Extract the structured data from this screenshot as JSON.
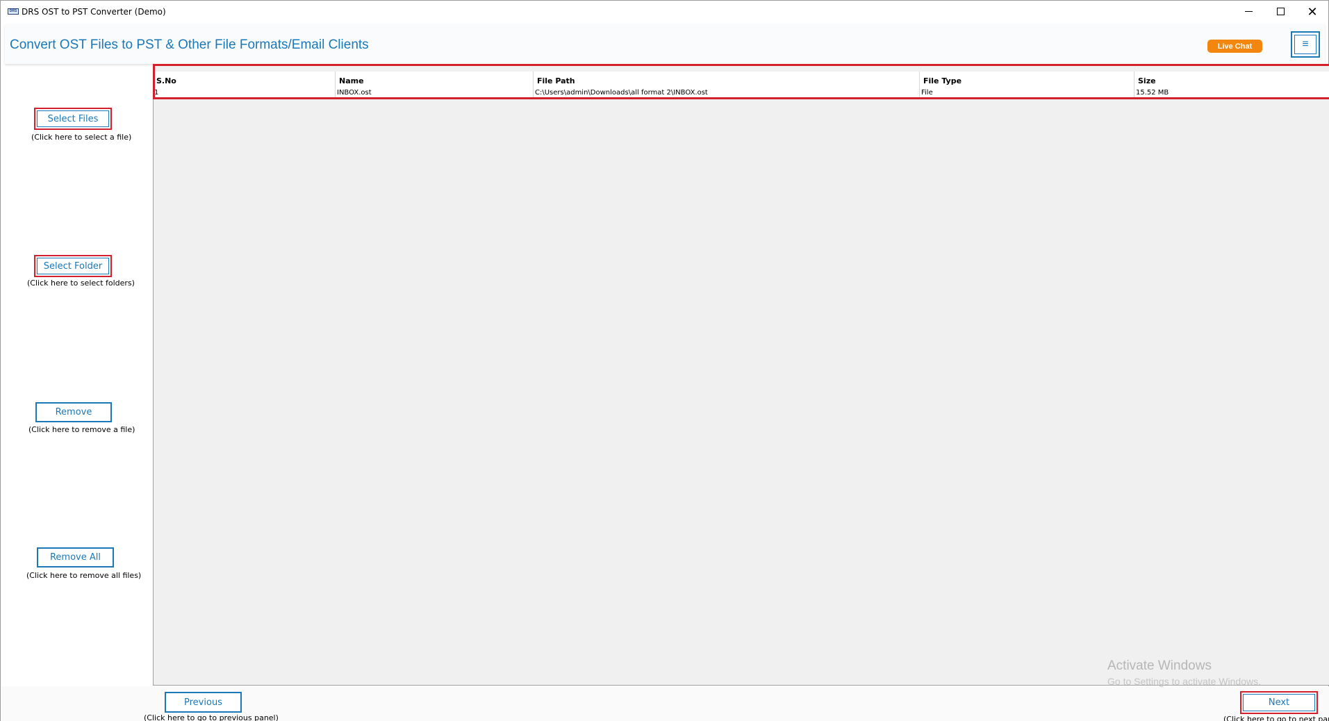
{
  "window": {
    "title": "DRS OST to PST Converter (Demo)",
    "icon": "drs-app-icon",
    "icon_text": "DRS",
    "minimize_icon": "minimize-icon",
    "maximize_icon": "maximize-icon",
    "close_glyph": "✕"
  },
  "header": {
    "title": "Convert OST Files to PST & Other File Formats/Email Clients",
    "live_chat": "Live Chat",
    "menu_glyph": "≡",
    "accent_color": "#1a78b8",
    "live_chat_color": "#f2860f"
  },
  "sidebar": {
    "select_files": {
      "label": "Select Files",
      "hint": "(Click here to select a file)"
    },
    "select_folder": {
      "label": "Select Folder",
      "hint": "(Click here to select folders)"
    },
    "remove": {
      "label": "Remove",
      "hint": "(Click here to remove a file)"
    },
    "remove_all": {
      "label": "Remove All",
      "hint": "(Click here to remove all files)"
    }
  },
  "table": {
    "columns": [
      "S.No",
      "Name",
      "File Path",
      "File Type",
      "Size"
    ],
    "rows": [
      [
        "1",
        "INBOX.ost",
        "C:\\Users\\admin\\Downloads\\all format 2\\INBOX.ost",
        "File",
        "15.52 MB"
      ]
    ]
  },
  "footer": {
    "previous": {
      "label": "Previous",
      "hint": "(Click here to go to previous panel)"
    },
    "next": {
      "label": "Next",
      "hint": "(Click here to go to next panel)"
    }
  },
  "watermark": {
    "line1": "Activate Windows",
    "line2": "Go to Settings to activate Windows."
  },
  "highlight_color": "#d4202c"
}
